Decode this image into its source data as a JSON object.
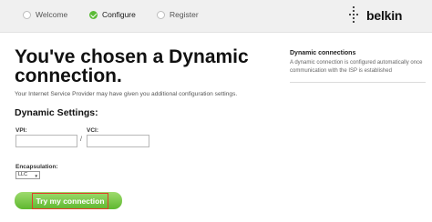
{
  "steps": [
    {
      "label": "Welcome",
      "state": "incomplete"
    },
    {
      "label": "Configure",
      "state": "complete"
    },
    {
      "label": "Register",
      "state": "incomplete"
    }
  ],
  "brand": {
    "name": "belkin"
  },
  "main": {
    "title": "You've chosen a Dynamic connection.",
    "subtitle": "Your Internet Service Provider may have given you additional configuration settings.",
    "settings_heading": "Dynamic Settings:",
    "vpi": {
      "label": "VPI:",
      "value": ""
    },
    "separator": "/",
    "vci": {
      "label": "VCI:",
      "value": ""
    },
    "encapsulation": {
      "label": "Encapsulation:",
      "selected": "LLC"
    },
    "try_button": {
      "label": "Try my connection"
    }
  },
  "sidebar": {
    "title": "Dynamic connections",
    "text": "A dynamic connection is configured automatically once communication with the ISP is established"
  },
  "colors": {
    "accent_green": "#5bbb36",
    "highlight_red": "#e13d2a"
  }
}
